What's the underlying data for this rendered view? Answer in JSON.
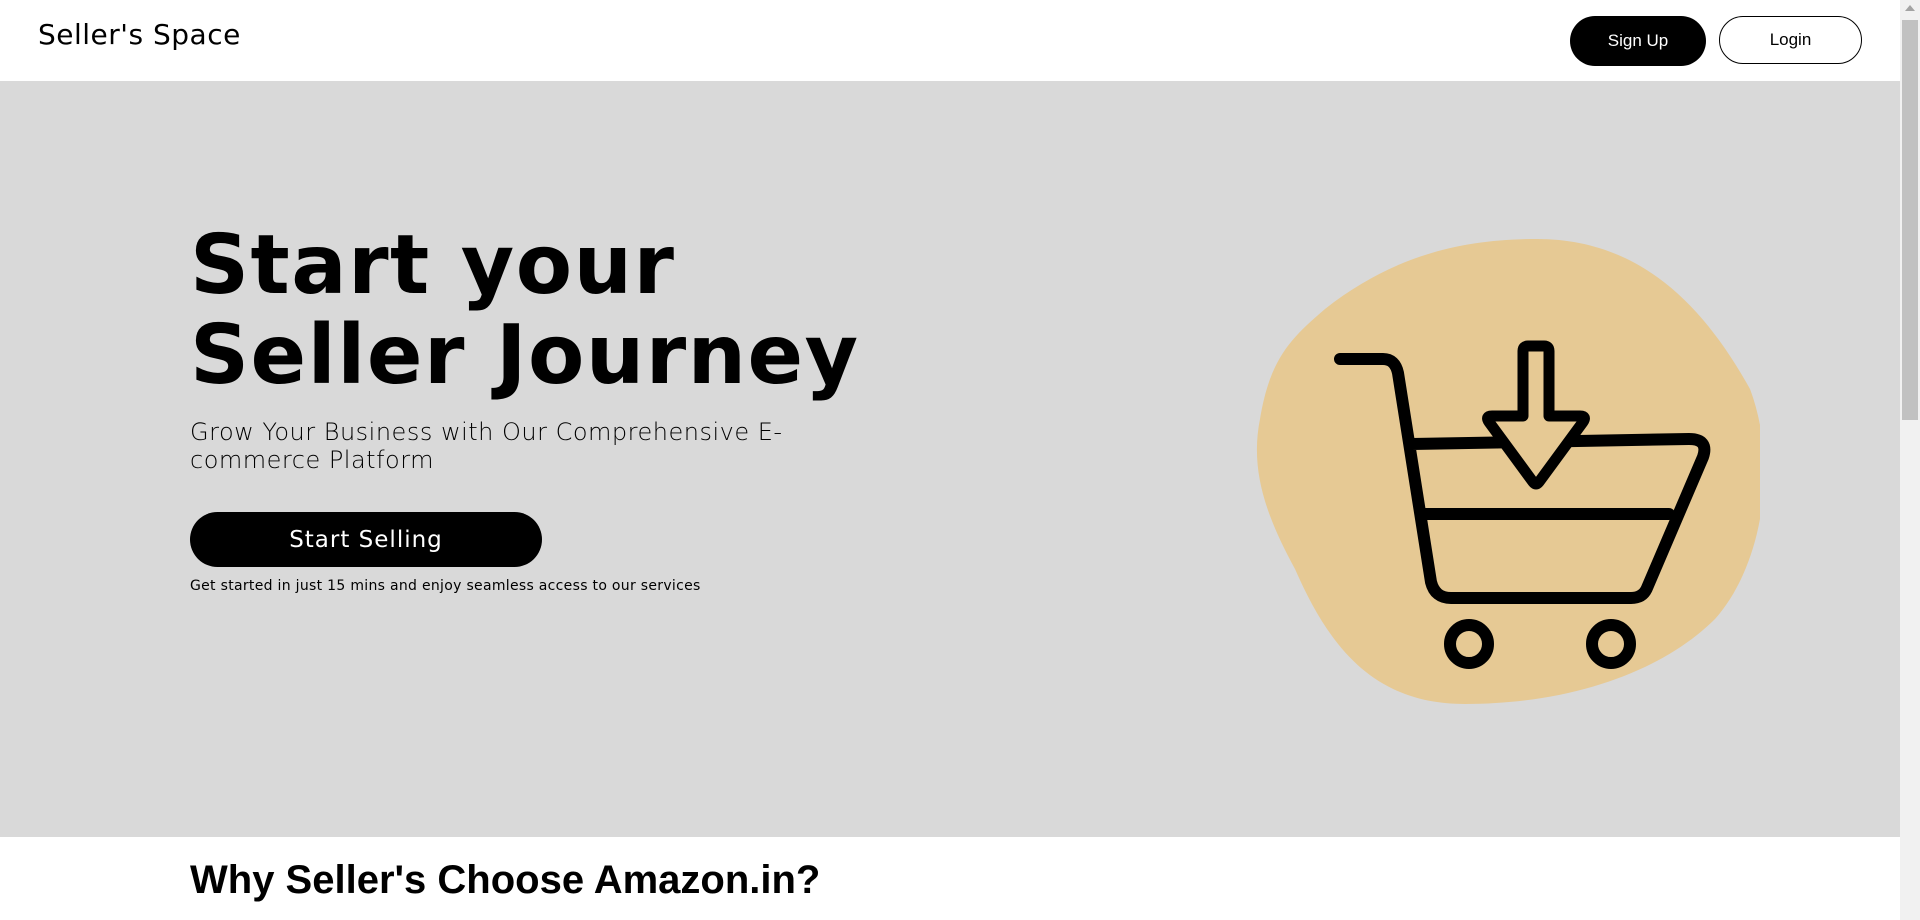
{
  "header": {
    "brand": "Seller's Space",
    "signup_label": "Sign Up",
    "login_label": "Login"
  },
  "hero": {
    "title": "Start your Seller Journey",
    "subtitle": "Grow Your Business with Our Comprehensive E-commerce Platform",
    "cta_label": "Start Selling",
    "note": "Get started in just 15 mins and enjoy seamless access to our services",
    "illustration_icon": "shopping-cart-download-icon",
    "blob_color": "#e6c994",
    "background_color": "#d9d9d9"
  },
  "features": {
    "title": "Why Seller's Choose Amazon.in?"
  }
}
